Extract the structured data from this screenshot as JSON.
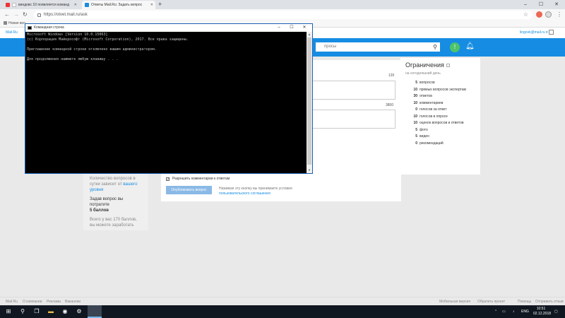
{
  "browser": {
    "tabs": [
      {
        "label": "виндовс 10 появляется команд",
        "active": false
      },
      {
        "label": "Ответы Mail.Ru: Задать вопрос",
        "active": true
      }
    ],
    "new_tab": "+",
    "window_controls": [
      "–",
      "☐",
      "✕"
    ],
    "url": "https://otvet.mail.ru/ask",
    "bookmark": "Новая вкл"
  },
  "page": {
    "logo": "Mail.Ru",
    "user": "lingovk@mail.ru ▾",
    "search_placeholder": "просы",
    "title_counter": "120",
    "text_counter": "3800",
    "left_card": {
      "line1": "Количество вопросов в сутки зависит от ",
      "link": "вашего уровня",
      "line2": "Задав вопрос вы потратите",
      "cost": "5 баллов",
      "line3": "Всего у вас 170 баллов, вы можете заработать"
    },
    "allow_comments": "Разрешить комментарии к ответам",
    "publish_button": "Опубликовать вопрос",
    "publish_note": "Нажимая эту кнопку вы принимаете условия",
    "publish_note_link": "пользовательского соглашения",
    "limits": {
      "title": "Ограничения",
      "subtitle": "на сегодняшний день",
      "items": [
        {
          "num": "5",
          "label": "вопросов"
        },
        {
          "num": "10",
          "label": "прямых вопросов экспертам"
        },
        {
          "num": "30",
          "label": "ответов"
        },
        {
          "num": "10",
          "label": "комментариев"
        },
        {
          "num": "0",
          "label": "голосов за ответ"
        },
        {
          "num": "10",
          "label": "голосов в опросе"
        },
        {
          "num": "10",
          "label": "оценок вопросов и ответов"
        },
        {
          "num": "5",
          "label": "фото"
        },
        {
          "num": "5",
          "label": "видео"
        },
        {
          "num": "0",
          "label": "рекомендаций"
        }
      ]
    },
    "footer": {
      "left": [
        "Mail.Ru",
        "О компании",
        "Реклама",
        "Вакансии"
      ],
      "right": [
        "Мобильная версия",
        "Обратить проект",
        "Помощь",
        "Отправить отзыв"
      ]
    }
  },
  "console": {
    "title": "Командная строка",
    "lines": [
      "Microsoft Windows [Version 10.0.15063]",
      "(c) Корпорация Майкрософт (Microsoft Corporation), 2017. Все права защищены.",
      "",
      "Приглашение командной строки отключено вашим администратором.",
      "",
      "Для продолжения нажмите любую клавишу . . ."
    ]
  },
  "taskbar": {
    "lang": "ENG",
    "time": "10:51",
    "date": "02.12.2018"
  },
  "colors": {
    "brand_blue": "#168de2",
    "green": "#4ec46a"
  }
}
